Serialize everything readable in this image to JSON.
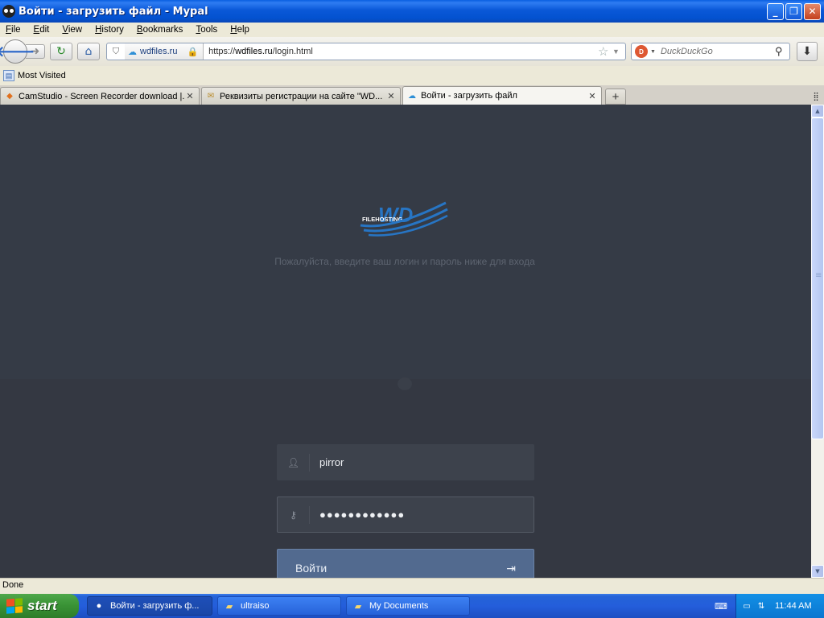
{
  "window": {
    "title": "Войти - загрузить файл - Mypal"
  },
  "menubar": {
    "items": [
      "File",
      "Edit",
      "View",
      "History",
      "Bookmarks",
      "Tools",
      "Help"
    ]
  },
  "navbar": {
    "site_identity": "wdfiles.ru",
    "url_prefix": "https://",
    "url_domain": "wdfiles.ru",
    "url_path": "/login.html",
    "search_placeholder": "DuckDuckGo"
  },
  "bookmarks": {
    "items": [
      "Most Visited"
    ]
  },
  "tabs": [
    {
      "label": "CamStudio - Screen Recorder download |...",
      "icon": "camstudio-icon",
      "active": false
    },
    {
      "label": "Реквизиты регистрации на сайте \"WD...",
      "icon": "envelope-icon",
      "active": false
    },
    {
      "label": "Войти - загрузить файл",
      "icon": "cloud-icon",
      "active": true
    }
  ],
  "page": {
    "logo_text": "WD",
    "logo_subtext": "FILEHOSTING",
    "message": "Пожалуйста, введите ваш логин и пароль ниже для входа",
    "username_value": "pirror",
    "password_value": "●●●●●●●●●●●●",
    "login_button_label": "Войти",
    "colors": {
      "background": "#353a44",
      "button": "#526a8f",
      "logo": "#2775c4"
    }
  },
  "statusbar": {
    "text": "Done"
  },
  "taskbar": {
    "start_label": "start",
    "tasks": [
      {
        "label": "Войти - загрузить ф...",
        "icon": "mypal-icon",
        "active": true
      },
      {
        "label": "ultraiso",
        "icon": "folder-icon",
        "active": false
      },
      {
        "label": "My Documents",
        "icon": "folder-icon",
        "active": false
      }
    ],
    "clock": "11:44 AM"
  }
}
